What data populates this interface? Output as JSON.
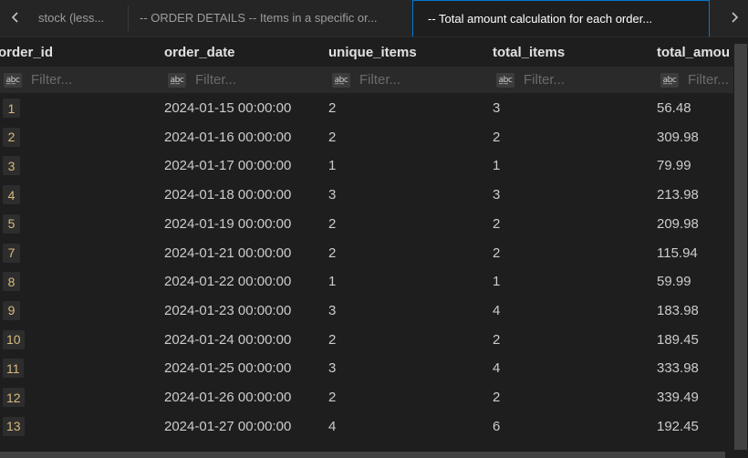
{
  "tabs": [
    {
      "label": "stock (less..."
    },
    {
      "label": "-- ORDER DETAILS -- Items in a specific or..."
    },
    {
      "label": "-- Total amount calculation for each order..."
    }
  ],
  "columns": [
    {
      "label": "order_id"
    },
    {
      "label": "order_date"
    },
    {
      "label": "unique_items"
    },
    {
      "label": "total_items"
    },
    {
      "label": "total_amou"
    }
  ],
  "filter": {
    "placeholder": "Filter...",
    "icon_text": "a̲b̲c"
  },
  "rows": [
    {
      "order_id": "1",
      "order_date": "2024-01-15 00:00:00",
      "unique_items": "2",
      "total_items": "3",
      "total_amount": "56.48"
    },
    {
      "order_id": "2",
      "order_date": "2024-01-16 00:00:00",
      "unique_items": "2",
      "total_items": "2",
      "total_amount": "309.98"
    },
    {
      "order_id": "3",
      "order_date": "2024-01-17 00:00:00",
      "unique_items": "1",
      "total_items": "1",
      "total_amount": "79.99"
    },
    {
      "order_id": "4",
      "order_date": "2024-01-18 00:00:00",
      "unique_items": "3",
      "total_items": "3",
      "total_amount": "213.98"
    },
    {
      "order_id": "5",
      "order_date": "2024-01-19 00:00:00",
      "unique_items": "2",
      "total_items": "2",
      "total_amount": "209.98"
    },
    {
      "order_id": "7",
      "order_date": "2024-01-21 00:00:00",
      "unique_items": "2",
      "total_items": "2",
      "total_amount": "115.94"
    },
    {
      "order_id": "8",
      "order_date": "2024-01-22 00:00:00",
      "unique_items": "1",
      "total_items": "1",
      "total_amount": "59.99"
    },
    {
      "order_id": "9",
      "order_date": "2024-01-23 00:00:00",
      "unique_items": "3",
      "total_items": "4",
      "total_amount": "183.98"
    },
    {
      "order_id": "10",
      "order_date": "2024-01-24 00:00:00",
      "unique_items": "2",
      "total_items": "2",
      "total_amount": "189.45"
    },
    {
      "order_id": "11",
      "order_date": "2024-01-25 00:00:00",
      "unique_items": "3",
      "total_items": "4",
      "total_amount": "333.98"
    },
    {
      "order_id": "12",
      "order_date": "2024-01-26 00:00:00",
      "unique_items": "2",
      "total_items": "2",
      "total_amount": "339.49"
    },
    {
      "order_id": "13",
      "order_date": "2024-01-27 00:00:00",
      "unique_items": "4",
      "total_items": "6",
      "total_amount": "192.45"
    }
  ],
  "colors": {
    "background": "#1e1e1e",
    "tabbar": "#252526",
    "active_tab_border": "#0078d4",
    "id_text": "#d7ba7d",
    "filter_row": "#2a2a2a"
  }
}
